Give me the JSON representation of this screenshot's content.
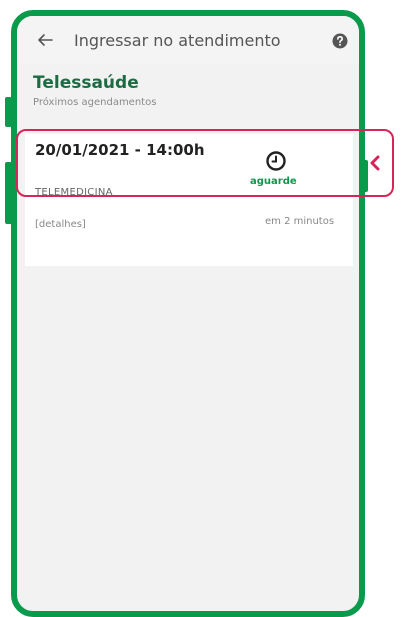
{
  "appbar": {
    "title": "Ingressar no atendimento",
    "back_icon": "arrow-left-icon",
    "help_icon": "help-circle-icon"
  },
  "section": {
    "title": "Telessaúde",
    "subtitle": "Próximos agendamentos"
  },
  "appointment": {
    "datetime": "20/01/2021 - 14:00h",
    "status": "aguarde",
    "type": "TELEMEDICINA",
    "details_link": "[detalhes]",
    "time_remaining": "em 2 minutos",
    "status_icon": "clock-icon"
  },
  "colors": {
    "brand_green": "#0a9a4c",
    "title_green": "#1e6b43",
    "highlight": "#d7245a"
  }
}
